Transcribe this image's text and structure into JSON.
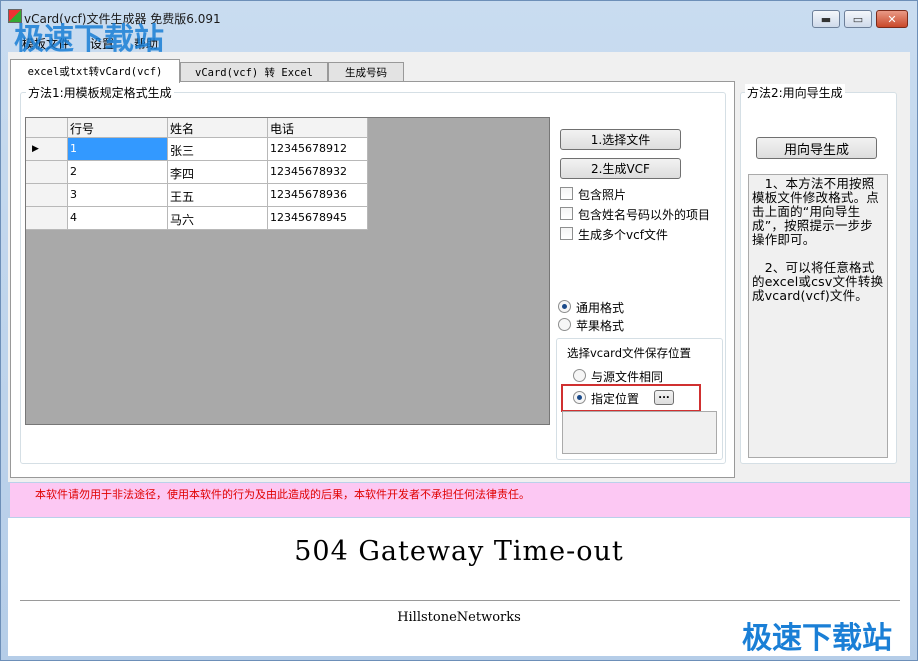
{
  "window": {
    "title": "vCard(vcf)文件生成器 免费版6.091",
    "min_glyph": "▬",
    "max_glyph": "▭",
    "close_glyph": "✕"
  },
  "menu": [
    "模板文件",
    "设置",
    "帮助"
  ],
  "tabs": [
    {
      "label": "excel或txt转vCard(vcf)",
      "active": true
    },
    {
      "label": "vCard(vcf) 转 Excel",
      "active": false
    },
    {
      "label": "生成号码",
      "active": false
    }
  ],
  "method1": {
    "title": "方法1:用模板规定格式生成",
    "grid": {
      "columns": [
        "行号",
        "姓名",
        "电话"
      ],
      "row_marker": "▶",
      "rows": [
        [
          "1",
          "张三",
          "12345678912"
        ],
        [
          "2",
          "李四",
          "12345678932"
        ],
        [
          "3",
          "王五",
          "12345678936"
        ],
        [
          "4",
          "马六",
          "12345678945"
        ]
      ]
    },
    "buttons": {
      "select_file": "1.选择文件",
      "generate": "2.生成VCF"
    },
    "checkboxes": [
      {
        "label": "包含照片",
        "checked": false
      },
      {
        "label": "包含姓名号码以外的项目",
        "checked": false
      },
      {
        "label": "生成多个vcf文件",
        "checked": false
      }
    ],
    "format_options": [
      {
        "label": "通用格式",
        "selected": true
      },
      {
        "label": "苹果格式",
        "selected": false
      }
    ],
    "save_location": {
      "title": "选择vcard文件保存位置",
      "options": [
        {
          "label": "与源文件相同",
          "selected": false
        },
        {
          "label": "指定位置",
          "selected": true
        }
      ],
      "browse_label": "..."
    }
  },
  "method2": {
    "title": "方法2:用向导生成",
    "wizard_button": "用向导生成",
    "help_text_1": "　1、本方法不用按照模板文件修改格式。点击上面的“用向导生成”，按照提示一步步操作即可。",
    "help_text_2": "　2、可以将任意格式的excel或csv文件转换成vcard(vcf)文件。"
  },
  "warning": "本软件请勿用于非法途径，使用本软件的行为及由此造成的后果，本软件开发者不承担任何法律责任。",
  "web_error": {
    "title": "504 Gateway Time-out",
    "footer": "HillstoneNetworks"
  },
  "watermark": "极速下载站",
  "colors": {
    "selection": "#3399ff",
    "warning_bg": "#fcc8f3",
    "warning_text": "#e00000",
    "highlight_box": "#d03030",
    "watermark": "#1a7fd6"
  }
}
